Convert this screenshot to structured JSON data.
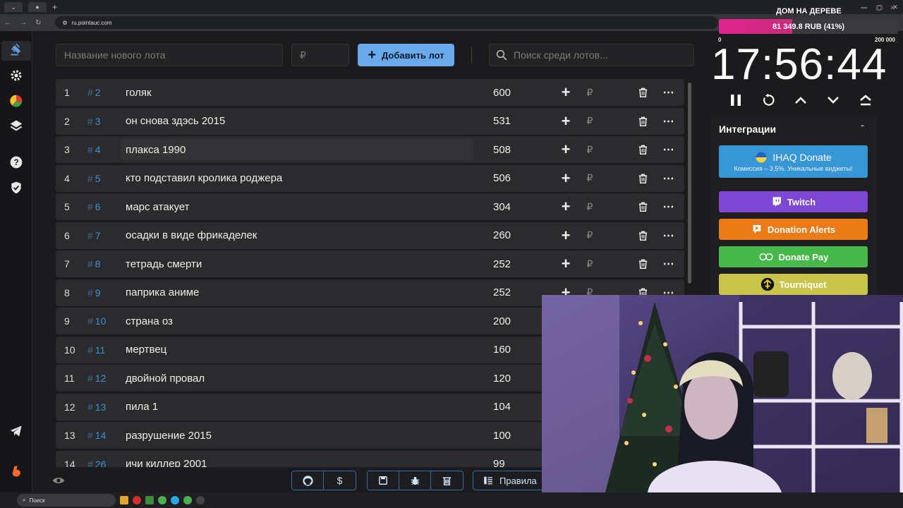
{
  "browser": {
    "url": "ru.pointauc.com"
  },
  "topbar": {
    "lot_name_placeholder": "Название нового лота",
    "amount_placeholder": "₽",
    "add_button_label": "Добавить лот",
    "search_placeholder": "Поиск среди лотов..."
  },
  "lots": [
    {
      "num": "1",
      "id": "2",
      "name": "голяк",
      "amount": "600"
    },
    {
      "num": "2",
      "id": "3",
      "name": "он снова здэсь 2015",
      "amount": "531"
    },
    {
      "num": "3",
      "id": "4",
      "name": "плакса 1990",
      "amount": "508"
    },
    {
      "num": "4",
      "id": "5",
      "name": "кто подставил кролика роджера",
      "amount": "506"
    },
    {
      "num": "5",
      "id": "6",
      "name": "марс атакует",
      "amount": "304"
    },
    {
      "num": "6",
      "id": "7",
      "name": "осадки в виде фрикаделек",
      "amount": "260"
    },
    {
      "num": "7",
      "id": "8",
      "name": "тетрадь смерти",
      "amount": "252"
    },
    {
      "num": "8",
      "id": "9",
      "name": "паприка аниме",
      "amount": "252"
    },
    {
      "num": "9",
      "id": "10",
      "name": "страна оз",
      "amount": "200"
    },
    {
      "num": "10",
      "id": "11",
      "name": "мертвец",
      "amount": "160"
    },
    {
      "num": "11",
      "id": "12",
      "name": " двойной провал",
      "amount": "120"
    },
    {
      "num": "12",
      "id": "13",
      "name": "пила 1",
      "amount": "104"
    },
    {
      "num": "13",
      "id": "14",
      "name": "разрушение 2015",
      "amount": "100"
    },
    {
      "num": "14",
      "id": "26",
      "name": "ичи киллер 2001",
      "amount": "99"
    }
  ],
  "lot_symbols": {
    "hash": "#",
    "rub": "₽"
  },
  "bottombar": {
    "rules_label": "Правила"
  },
  "goal": {
    "title": "ДОМ НА ДЕРЕВЕ",
    "progress_text": "81 349.8 RUB (41%)",
    "progress_fraction": 0.41,
    "min_label": "0",
    "max_label": "200 000"
  },
  "timer": {
    "value": "17:56:44"
  },
  "integrations": {
    "title": "Интеграции",
    "ihaq_label": "IHAQ Donate",
    "ihaq_subtitle": "Комиссия – 3,5%. Уникальные виджеты!",
    "twitch_label": "Twitch",
    "donation_alerts_label": "Donation Alerts",
    "donate_pay_label": "Donate Pay",
    "tourniquet_label": "Tourniquet"
  },
  "taskbar": {
    "search_label": "Поиск"
  },
  "colors": {
    "accent": "#6aa9ec",
    "goal_fill": "#e1248f",
    "twitch": "#7d48d4",
    "donation_alerts": "#ea7b16",
    "donate_pay": "#46b94a",
    "tourniquet": "#c9c54a",
    "ihaq": "#3796d6"
  }
}
